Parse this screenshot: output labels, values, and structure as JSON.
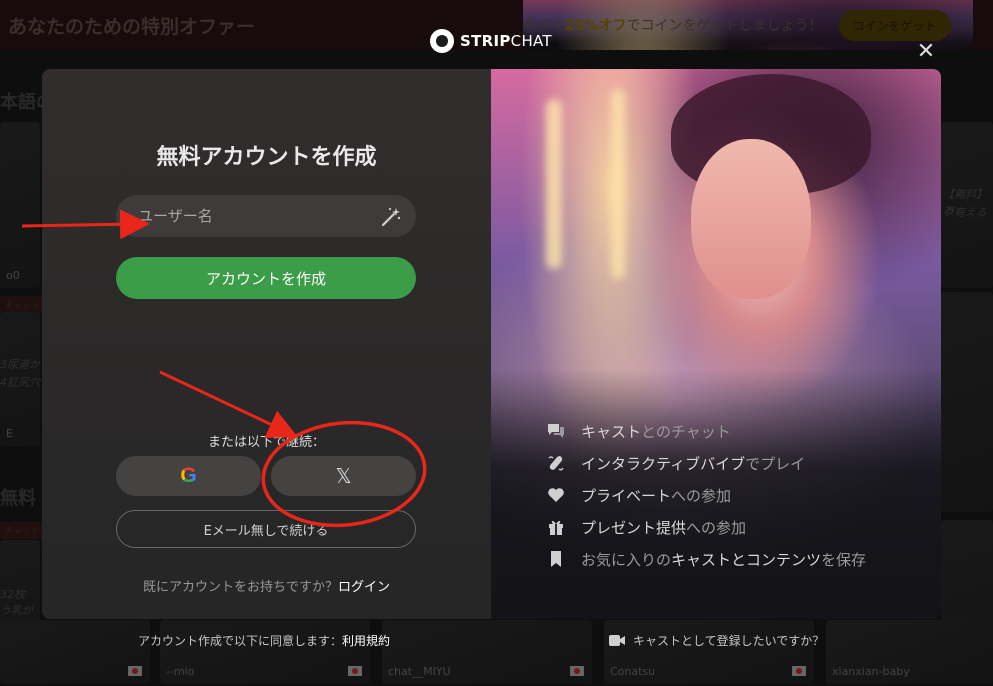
{
  "background": {
    "banner_title": "あなたのための特別オファー",
    "promo_prefix": "今すぐ",
    "promo_highlight": "25%オフ",
    "promo_suffix": "でコインをゲットしましょう！",
    "promo_button": "コインをゲット",
    "section_1": "本語の",
    "section_2": "無料",
    "tag_1": "チャットで",
    "tag_2": "チャットで",
    "card_label_1": "o0",
    "card_label_2": "E",
    "card_label_3": "fo",
    "card_label_4": "--mio",
    "card_label_5": "chat__MIYU",
    "card_label_6": "Conatsu",
    "card_label_7": "xianxian-baby",
    "side_text_1": "【無料】お",
    "side_text_2": "ク有える",
    "side_text_3": "3尿道か",
    "side_text_4": "4肛尻穴",
    "side_text_5": "32枚",
    "side_text_6": "う乳が"
  },
  "header": {
    "logo_bold": "STRIP",
    "logo_thin": "CHAT",
    "close": "✕"
  },
  "form": {
    "title": "無料アカウントを作成",
    "username_placeholder": "ユーザー名",
    "create_button": "アカウントを作成",
    "or_continue": "または以下で継続：",
    "google_letter": "G",
    "x_letter": "𝕏",
    "no_email_button": "Eメール無しで続ける",
    "have_account": "既にアカウントをお持ちですか？",
    "login_link": "ログイン"
  },
  "features": [
    {
      "icon": "chat-icon",
      "bold": "キャスト",
      "rest": "とのチャット"
    },
    {
      "icon": "vibe-icon",
      "bold": "インタラクティブバイブ",
      "rest": "でプレイ"
    },
    {
      "icon": "heart-icon",
      "bold": "プライベート",
      "rest": "への参加"
    },
    {
      "icon": "gift-icon",
      "bold": "プレゼント提供",
      "rest": "への参加"
    },
    {
      "icon": "bookmark-icon",
      "pre": "お気に入りの",
      "bold": "キャストとコンテンツ",
      "rest": "を保存"
    }
  ],
  "footer": {
    "terms_prefix": "アカウント作成で以下に同意します：",
    "terms_link": "利用規約",
    "cast_question": "キャストとして登録したいですか？"
  },
  "colors": {
    "accent_green": "#3b9d48",
    "annotation_red": "#e8271a"
  }
}
